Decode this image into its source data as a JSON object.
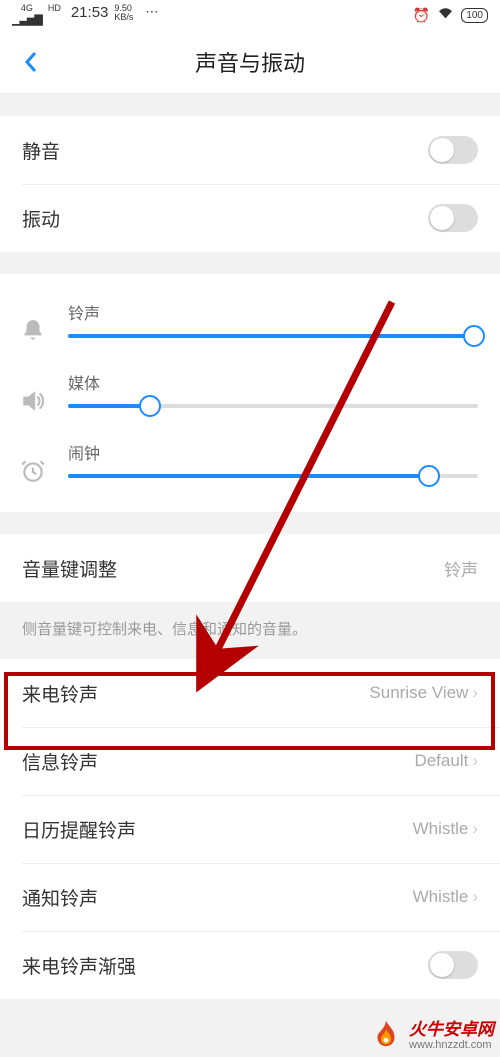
{
  "status": {
    "net_label_top": "4G",
    "net_label_bottom": "HD",
    "time": "21:53",
    "speed_top": "9.50",
    "speed_bottom": "KB/s",
    "battery": "100"
  },
  "header": {
    "title": "声音与振动"
  },
  "toggles": {
    "silent": "静音",
    "vibrate": "振动",
    "fade_in": "来电铃声渐强"
  },
  "sliders": {
    "ringtone": "铃声",
    "media": "媒体",
    "alarm": "闹钟",
    "ringtone_pct": 99,
    "media_pct": 20,
    "alarm_pct": 88
  },
  "volume_key": {
    "label": "音量键调整",
    "value": "铃声",
    "desc": "侧音量键可控制来电、信息和通知的音量。"
  },
  "rows": {
    "call_ringtone": {
      "label": "来电铃声",
      "value": "Sunrise View"
    },
    "msg_ringtone": {
      "label": "信息铃声",
      "value": "Default"
    },
    "calendar_ringtone": {
      "label": "日历提醒铃声",
      "value": "Whistle"
    },
    "notif_ringtone": {
      "label": "通知铃声",
      "value": "Whistle"
    }
  },
  "watermark": {
    "name": "火牛安卓网",
    "url": "www.hnzzdt.com"
  },
  "chevron": "›"
}
